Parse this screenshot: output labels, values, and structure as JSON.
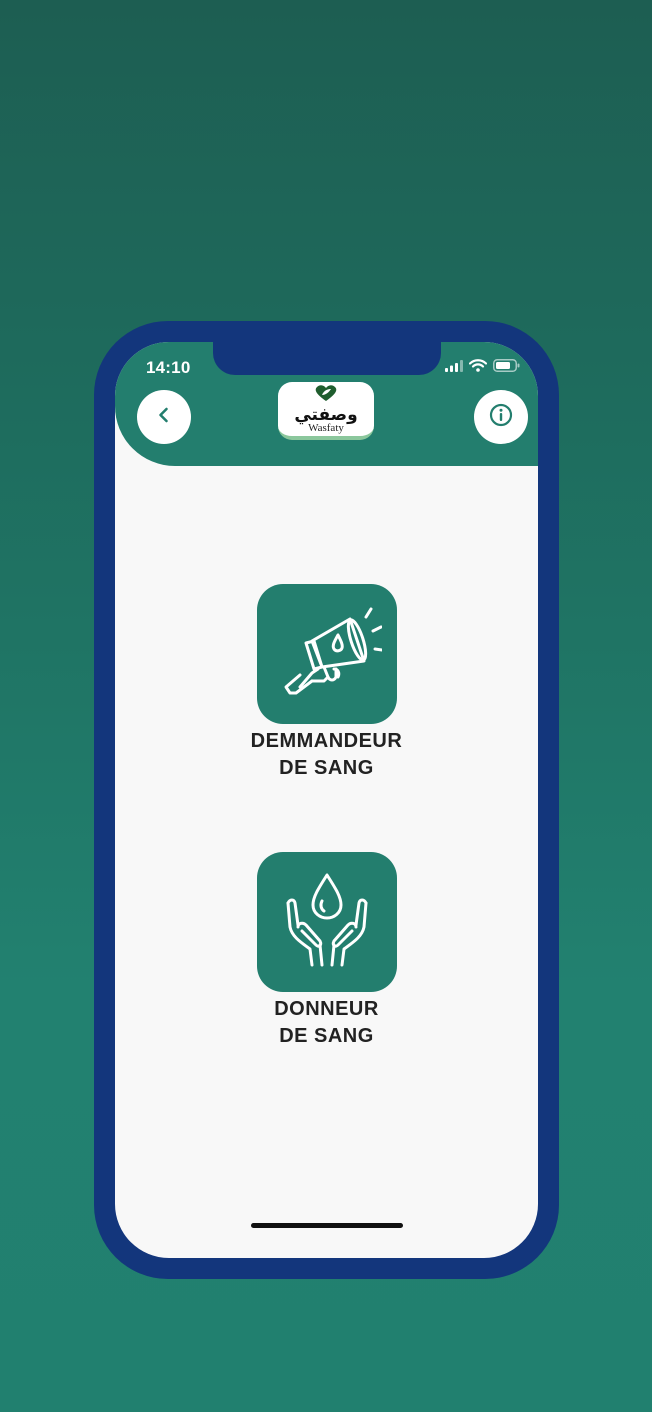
{
  "status_bar": {
    "time": "14:10"
  },
  "header": {
    "back_icon": "chevron-left-icon",
    "info_icon": "info-circle-icon",
    "logo": {
      "arabic_text": "وصفتي",
      "latin_text": "Wasfaty"
    }
  },
  "options": [
    {
      "icon": "megaphone-blood-drop-icon",
      "label": "DEMMANDEUR\nDE SANG"
    },
    {
      "icon": "hands-blood-drop-icon",
      "label": "DONNEUR\nDE SANG"
    }
  ],
  "colors": {
    "accent": "#237e6e",
    "frame": "#13367c",
    "screen_bg": "#f8f8f8"
  }
}
